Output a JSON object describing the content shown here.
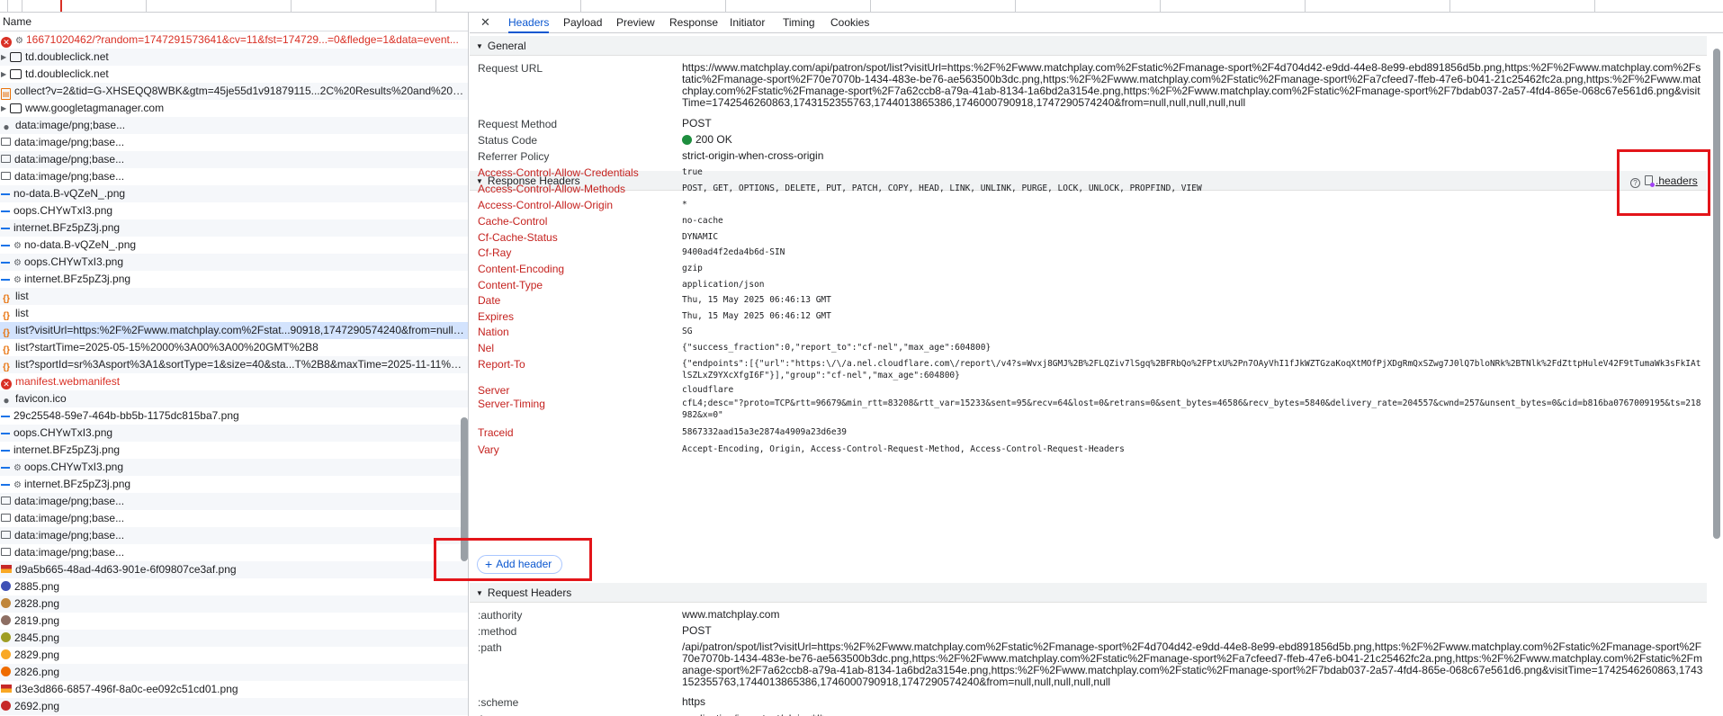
{
  "network_list": {
    "column_name": "Name",
    "requests": [
      {
        "icon": "error-icon",
        "name": "16671020462/?random=1747291573641&cv=11&fst=174729...=0&fledge=1&data=event...",
        "red": true,
        "gear": true
      },
      {
        "icon": "frame-icon",
        "name": "td.doubleclick.net",
        "expand": true
      },
      {
        "icon": "frame-icon",
        "name": "td.doubleclick.net",
        "expand": true
      },
      {
        "icon": "document-icon",
        "name": "collect?v=2&tid=G-XHSEQQ8WBK&gtm=45je55d1v91879115...2C%20Results%20and%20Bet..."
      },
      {
        "icon": "frame-icon",
        "name": "www.googletagmanager.com",
        "expand": true
      },
      {
        "icon": "dot-icon",
        "name": "data:image/png;base..."
      },
      {
        "icon": "image-icon",
        "name": "data:image/png;base..."
      },
      {
        "icon": "image-icon",
        "name": "data:image/png;base..."
      },
      {
        "icon": "image-icon",
        "name": "data:image/png;base..."
      },
      {
        "icon": "dash-icon",
        "name": "no-data.B-vQZeN_.png"
      },
      {
        "icon": "dash-icon",
        "name": "oops.CHYwTxI3.png"
      },
      {
        "icon": "dash-icon",
        "name": "internet.BFz5pZ3j.png"
      },
      {
        "icon": "dash-icon",
        "name": "no-data.B-vQZeN_.png",
        "gear": true
      },
      {
        "icon": "dash-icon",
        "name": "oops.CHYwTxI3.png",
        "gear": true
      },
      {
        "icon": "dash-icon",
        "name": "internet.BFz5pZ3j.png",
        "gear": true
      },
      {
        "icon": "xhr-icon",
        "name": "list"
      },
      {
        "icon": "xhr-icon",
        "name": "list"
      },
      {
        "icon": "xhr-icon",
        "name": "list?visitUrl=https:%2F%2Fwww.matchplay.com%2Fstat...90918,1747290574240&from=null,n...",
        "selected": true
      },
      {
        "icon": "xhr-icon",
        "name": "list?startTime=2025-05-15%2000%3A00%3A00%20GMT%2B8"
      },
      {
        "icon": "xhr-icon",
        "name": "list?sportId=sr%3Asport%3A1&sortType=1&size=40&sta...T%2B8&maxTime=2025-11-11%2..."
      },
      {
        "icon": "error-icon",
        "name": "manifest.webmanifest",
        "red": true
      },
      {
        "icon": "dot-icon",
        "name": "favicon.ico"
      },
      {
        "icon": "dash-icon",
        "name": "29c25548-59e7-464b-bb5b-1175dc815ba7.png"
      },
      {
        "icon": "dash-icon",
        "name": "oops.CHYwTxI3.png"
      },
      {
        "icon": "dash-icon",
        "name": "internet.BFz5pZ3j.png"
      },
      {
        "icon": "dash-icon",
        "name": "oops.CHYwTxI3.png",
        "gear": true
      },
      {
        "icon": "dash-icon",
        "name": "internet.BFz5pZ3j.png",
        "gear": true
      },
      {
        "icon": "image-icon",
        "name": "data:image/png;base..."
      },
      {
        "icon": "image-icon",
        "name": "data:image/png;base..."
      },
      {
        "icon": "image-icon",
        "name": "data:image/png;base..."
      },
      {
        "icon": "image-icon",
        "name": "data:image/png;base..."
      },
      {
        "icon": "flag-icon",
        "name": "d9a5b665-48ad-4d63-901e-6f09807ce3af.png"
      },
      {
        "icon": "ball-icon",
        "name": "2885.png",
        "color": "#3f51b5"
      },
      {
        "icon": "ball-icon",
        "name": "2828.png",
        "color": "#c0863b"
      },
      {
        "icon": "ball-icon",
        "name": "2819.png",
        "color": "#8d6e63"
      },
      {
        "icon": "ball-icon",
        "name": "2845.png",
        "color": "#9e9d24"
      },
      {
        "icon": "ball-icon",
        "name": "2829.png",
        "color": "#f9a825"
      },
      {
        "icon": "ball-icon",
        "name": "2826.png",
        "color": "#ef6c00"
      },
      {
        "icon": "flag-icon",
        "name": "d3e3d866-6857-496f-8a0c-ee092c51cd01.png"
      },
      {
        "icon": "ball-icon",
        "name": "2692.png",
        "color": "#c62828"
      }
    ]
  },
  "tabs": [
    "Headers",
    "Payload",
    "Preview",
    "Response",
    "Initiator",
    "Timing",
    "Cookies"
  ],
  "general": {
    "title": "General",
    "request_url_key": "Request URL",
    "request_url": "https://www.matchplay.com/api/patron/spot/list?visitUrl=https:%2F%2Fwww.matchplay.com%2Fstatic%2Fmanage-sport%2F4d704d42-e9dd-44e8-8e99-ebd891856d5b.png,https:%2F%2Fwww.matchplay.com%2Fstatic%2Fmanage-sport%2F70e7070b-1434-483e-be76-ae563500b3dc.png,https:%2F%2Fwww.matchplay.com%2Fstatic%2Fmanage-sport%2Fa7cfeed7-ffeb-47e6-b041-21c25462fc2a.png,https:%2F%2Fwww.matchplay.com%2Fstatic%2Fmanage-sport%2F7a62ccb8-a79a-41ab-8134-1a6bd2a3154e.png,https:%2F%2Fwww.matchplay.com%2Fstatic%2Fmanage-sport%2F7bdab037-2a57-4fd4-865e-068c67e561d6.png&visitTime=1742546260863,1743152355763,1744013865386,1746000790918,1747290574240&from=null,null,null,null,null",
    "method_key": "Request Method",
    "method": "POST",
    "status_key": "Status Code",
    "status": "200 OK",
    "referrer_key": "Referrer Policy",
    "referrer": "strict-origin-when-cross-origin"
  },
  "response_headers": {
    "title": "Response Headers",
    "file_link": ".headers",
    "add_header": "Add header",
    "rows": [
      {
        "k": "Access-Control-Allow-Credentials",
        "v": "true"
      },
      {
        "k": "Access-Control-Allow-Methods",
        "v": "POST, GET, OPTIONS, DELETE, PUT, PATCH, COPY, HEAD, LINK, UNLINK, PURGE, LOCK, UNLOCK, PROPFIND, VIEW"
      },
      {
        "k": "Access-Control-Allow-Origin",
        "v": "*"
      },
      {
        "k": "Cache-Control",
        "v": "no-cache"
      },
      {
        "k": "Cf-Cache-Status",
        "v": "DYNAMIC"
      },
      {
        "k": "Cf-Ray",
        "v": "9400ad4f2eda4b6d-SIN"
      },
      {
        "k": "Content-Encoding",
        "v": "gzip"
      },
      {
        "k": "Content-Type",
        "v": "application/json"
      },
      {
        "k": "Date",
        "v": "Thu, 15 May 2025 06:46:13 GMT"
      },
      {
        "k": "Expires",
        "v": "Thu, 15 May 2025 06:46:12 GMT"
      },
      {
        "k": "Nation",
        "v": "SG"
      },
      {
        "k": "Nel",
        "v": "{\"success_fraction\":0,\"report_to\":\"cf-nel\",\"max_age\":604800}"
      },
      {
        "k": "Report-To",
        "v": "{\"endpoints\":[{\"url\":\"https:\\/\\/a.nel.cloudflare.com\\/report\\/v4?s=Wvxj8GMJ%2B%2FLQZiv7lSgq%2BFRbQo%2FPtxU%2Pn7OAyVhI1fJkWZTGzaKoqXtMOfPjXDgRmQxSZwg7J0lQ7bloNRk%2BTNlk%2FdZttpHuleV42F9tTumaWk3sFkIAtlSZLxZ9YXcXfgI6F\"}],\"group\":\"cf-nel\",\"max_age\":604800}"
      },
      {
        "k": "Server",
        "v": "cloudflare"
      },
      {
        "k": "Server-Timing",
        "v": "cfL4;desc=\"?proto=TCP&rtt=96679&min_rtt=83208&rtt_var=15233&sent=95&recv=64&lost=0&retrans=0&sent_bytes=46586&recv_bytes=5840&delivery_rate=204557&cwnd=257&unsent_bytes=0&cid=b816ba0767009195&ts=218982&x=0\""
      },
      {
        "k": "Traceid",
        "v": "5867332aad15a3e2874a4909a23d6e39"
      },
      {
        "k": "Vary",
        "v": "Accept-Encoding, Origin, Access-Control-Request-Method, Access-Control-Request-Headers"
      }
    ]
  },
  "request_headers": {
    "title": "Request Headers",
    "rows": [
      {
        "k": ":authority",
        "v": "www.matchplay.com"
      },
      {
        "k": ":method",
        "v": "POST"
      },
      {
        "k": ":path",
        "v": "/api/patron/spot/list?visitUrl=https:%2F%2Fwww.matchplay.com%2Fstatic%2Fmanage-sport%2F4d704d42-e9dd-44e8-8e99-ebd891856d5b.png,https:%2F%2Fwww.matchplay.com%2Fstatic%2Fmanage-sport%2F70e7070b-1434-483e-be76-ae563500b3dc.png,https:%2F%2Fwww.matchplay.com%2Fstatic%2Fmanage-sport%2Fa7cfeed7-ffeb-47e6-b041-21c25462fc2a.png,https:%2F%2Fwww.matchplay.com%2Fstatic%2Fmanage-sport%2F7a62ccb8-a79a-41ab-8134-1a6bd2a3154e.png,https:%2F%2Fwww.matchplay.com%2Fstatic%2Fmanage-sport%2F7bdab037-2a57-4fd4-865e-068c67e561d6.png&visitTime=1742546260863,1743152355763,1744013865386,1746000790918,1747290574240&from=null,null,null,null,null"
      },
      {
        "k": ":scheme",
        "v": "https"
      },
      {
        "k": "Accept",
        "v": "application/json, text/plain, */*"
      }
    ]
  },
  "colors": {
    "highlight": "#e3151a",
    "accent": "#0b57d0",
    "selected_row": "#d3e3fd"
  }
}
